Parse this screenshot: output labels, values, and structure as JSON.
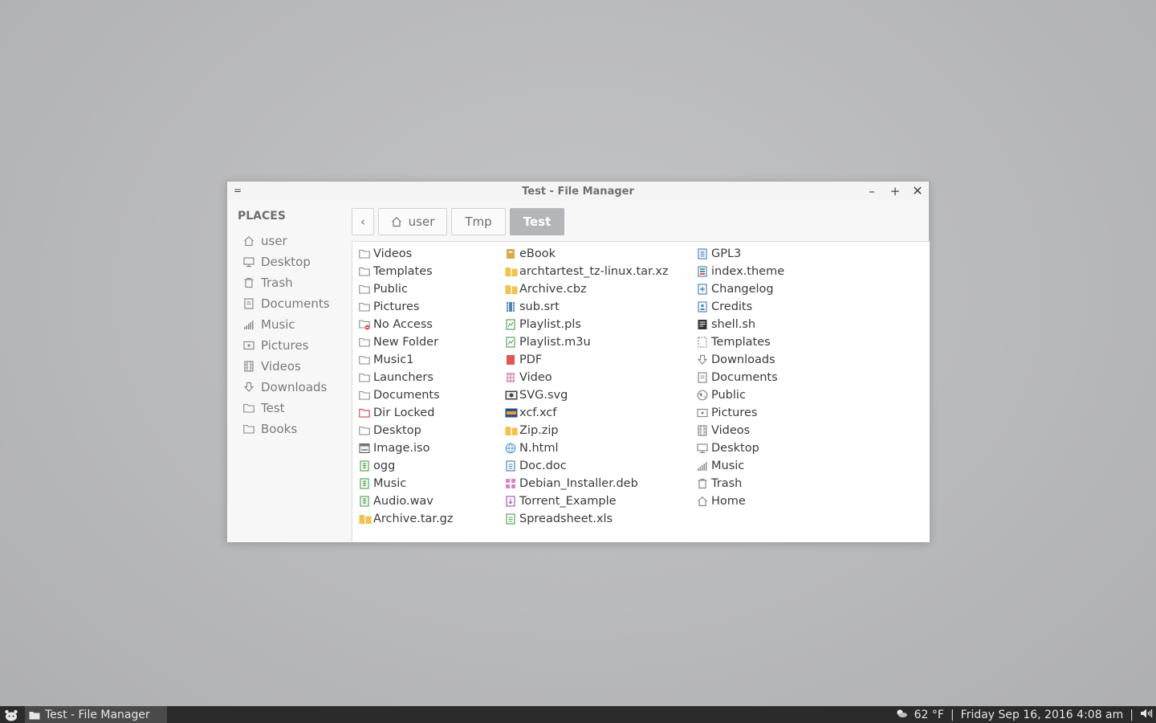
{
  "window": {
    "title": "Test - File Manager",
    "menu_glyph": "=",
    "minimize_glyph": "–",
    "maximize_glyph": "+",
    "close_glyph": "✕"
  },
  "sidebar": {
    "heading": "PLACES",
    "items": [
      {
        "label": "user",
        "icon": "home-icon"
      },
      {
        "label": "Desktop",
        "icon": "desktop-icon"
      },
      {
        "label": "Trash",
        "icon": "trash-icon"
      },
      {
        "label": "Documents",
        "icon": "document-icon"
      },
      {
        "label": "Music",
        "icon": "music-icon"
      },
      {
        "label": "Pictures",
        "icon": "pictures-icon"
      },
      {
        "label": "Videos",
        "icon": "video-icon"
      },
      {
        "label": "Downloads",
        "icon": "download-icon"
      },
      {
        "label": "Test",
        "icon": "folder-icon"
      },
      {
        "label": "Books",
        "icon": "folder-icon"
      }
    ]
  },
  "pathbar": {
    "back_glyph": "‹",
    "crumbs": [
      "user",
      "Tmp",
      "Test"
    ]
  },
  "files": {
    "col1": [
      "Videos",
      "Templates",
      "Public",
      "Pictures",
      "No Access",
      "New Folder",
      "Music1",
      "Launchers",
      "Documents",
      "Dir Locked",
      "Desktop",
      "Image.iso",
      "ogg",
      "Music",
      "Audio.wav",
      "Archive.tar.gz"
    ],
    "col2": [
      "eBook",
      "archtartest_tz-linux.tar.xz",
      "Archive.cbz",
      "sub.srt",
      "Playlist.pls",
      "Playlist.m3u",
      "PDF",
      "Video",
      "SVG.svg",
      "xcf.xcf",
      "Zip.zip",
      "N.html",
      "Doc.doc",
      "Debian_Installer.deb",
      "Torrent_Example",
      "Spreadsheet.xls"
    ],
    "col3": [
      "GPL3",
      "index.theme",
      "Changelog",
      "Credits",
      "shell.sh",
      "Templates",
      "Downloads",
      "Documents",
      "Public",
      "Pictures",
      "Videos",
      "Desktop",
      "Music",
      "Trash",
      "Home"
    ]
  },
  "taskbar": {
    "task_label": "Test - File Manager",
    "weather": "62 °F",
    "separator": "|",
    "datetime": "Friday Sep 16, 2016  4:08 am"
  },
  "colors": {
    "accent_crumb": "#b3b5b9",
    "taskbar": "#2b2b2b",
    "archive_yellow": "#f2c14e",
    "audio_green": "#5aa55a",
    "pdf_red": "#e25555",
    "locked_red": "#d9534f"
  }
}
